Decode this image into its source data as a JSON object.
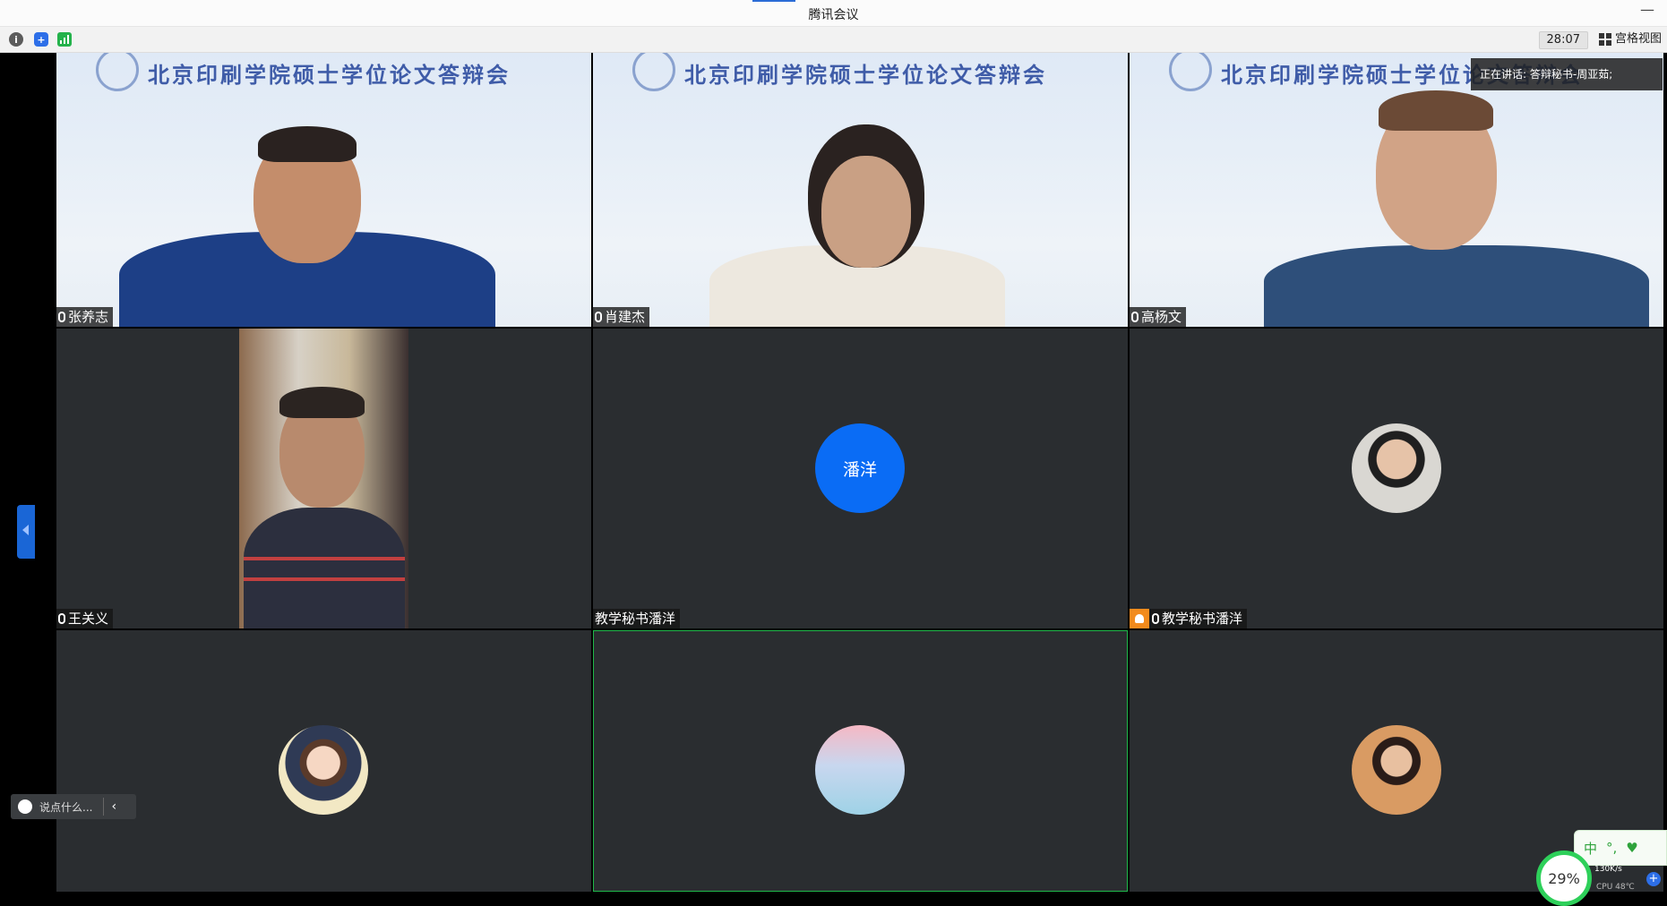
{
  "window": {
    "title": "腾讯会议"
  },
  "toolbar": {
    "timer": "28:07",
    "view_label": "宫格视图"
  },
  "banner_text": "北京印刷学院硕士学位论文答辩会",
  "speaking": {
    "text": "正在讲话: 答辩秘书-周亚茹;"
  },
  "participants": [
    {
      "name": "张养志"
    },
    {
      "name": "肖建杰"
    },
    {
      "name": "高杨文"
    },
    {
      "name": "王关义"
    },
    {
      "name": "教学秘书潘洋",
      "avatar_text": "潘洋"
    },
    {
      "name": "教学秘书潘洋"
    }
  ],
  "chat": {
    "placeholder": "说点什么..."
  },
  "system_tray": {
    "ime_label": "中",
    "cpu_percent": "29%",
    "net_speed": "130K/s",
    "cpu_label": "CPU 48℃"
  },
  "colors": {
    "tile_bg": "#2a2d30",
    "avatar_blue": "#0a6cf5",
    "active_border": "#1fb84a",
    "host_badge": "#f28b1d"
  }
}
